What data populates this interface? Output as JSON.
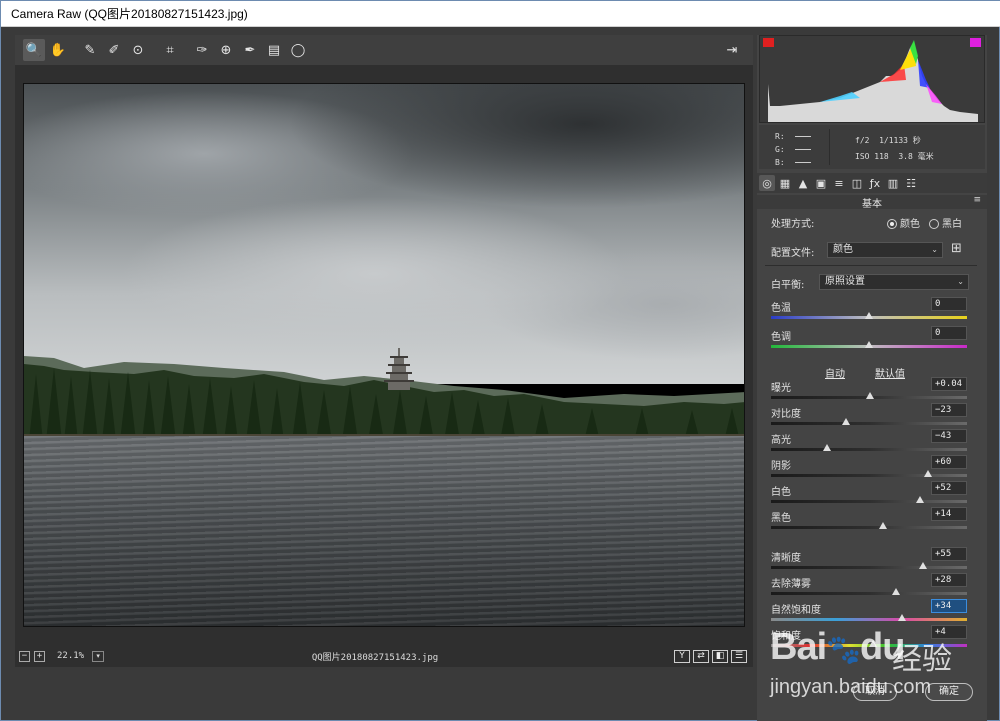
{
  "window": {
    "title": "Camera Raw (QQ图片20180827151423.jpg)"
  },
  "toolbar": {
    "tools": [
      {
        "icon": "zoom-icon",
        "glyph": "🔍"
      },
      {
        "icon": "hand-icon",
        "glyph": "✋"
      },
      {
        "icon": "white-balance-icon",
        "glyph": "✎"
      },
      {
        "icon": "color-sampler-icon",
        "glyph": "✐"
      },
      {
        "icon": "targeted-adjustment-icon",
        "glyph": "⊙"
      },
      {
        "icon": "crop-icon",
        "glyph": "⌗"
      },
      {
        "icon": "spot-removal-icon",
        "glyph": "✑"
      },
      {
        "icon": "red-eye-icon",
        "glyph": "⊕"
      },
      {
        "icon": "adjustment-brush-icon",
        "glyph": "✒"
      },
      {
        "icon": "graduated-filter-icon",
        "glyph": "▤"
      },
      {
        "icon": "radial-filter-icon",
        "glyph": "◯"
      }
    ],
    "open_object_icon": "⇥"
  },
  "status": {
    "zoom_minus": "−",
    "zoom_plus": "+",
    "zoom": "22.1%",
    "zoom_dropdown": "▾",
    "filename": "QQ图片20180827151423.jpg",
    "view_buttons": [
      "Y",
      "⇄",
      "◧",
      "☰"
    ]
  },
  "histogram": {
    "clip_shadow_color": "#e02020",
    "clip_highlight_color": "#e020e0"
  },
  "info": {
    "r_label": "R:",
    "g_label": "G:",
    "b_label": "B:",
    "aperture": "f/2",
    "shutter": "1/1133 秒",
    "iso": "ISO 118",
    "focal": "3.8 毫米"
  },
  "tabs": [
    "◎",
    "▦",
    "▲",
    "▣",
    "≡",
    "◫",
    "ƒx",
    "▥",
    "☷"
  ],
  "panel": {
    "title": "基本",
    "menu_icon": "≡",
    "treatment_label": "处理方式:",
    "treatment_color": "颜色",
    "treatment_bw": "黑白",
    "profile_label": "配置文件:",
    "profile_value": "颜色",
    "profile_grid_icon": "⊞",
    "wb_label": "白平衡:",
    "wb_value": "原照设置",
    "auto": "自动",
    "default": "默认值"
  },
  "sliders": [
    {
      "label": "色温",
      "value": "0",
      "pos": 0.5,
      "track": "temp"
    },
    {
      "label": "色调",
      "value": "0",
      "pos": 0.5,
      "track": "tint"
    },
    {
      "label": "曝光",
      "value": "+0.04",
      "pos": 0.505,
      "track": "gray"
    },
    {
      "label": "对比度",
      "value": "−23",
      "pos": 0.385,
      "track": "gray"
    },
    {
      "label": "高光",
      "value": "−43",
      "pos": 0.285,
      "track": "gray"
    },
    {
      "label": "阴影",
      "value": "+60",
      "pos": 0.8,
      "track": "gray"
    },
    {
      "label": "白色",
      "value": "+52",
      "pos": 0.76,
      "track": "gray"
    },
    {
      "label": "黑色",
      "value": "+14",
      "pos": 0.57,
      "track": "gray"
    },
    {
      "label": "清晰度",
      "value": "+55",
      "pos": 0.775,
      "track": "gray"
    },
    {
      "label": "去除薄雾",
      "value": "+28",
      "pos": 0.64,
      "track": "gray"
    },
    {
      "label": "自然饱和度",
      "value": "+34",
      "pos": 0.67,
      "track": "vib",
      "focus": true
    },
    {
      "label": "饱和度",
      "value": "+4",
      "pos": 0.52,
      "track": "sat"
    }
  ],
  "footer": {
    "cancel": "取消",
    "done": "确定"
  },
  "watermark": {
    "logo": "Bai",
    "logo2": "du",
    "cn": "经验",
    "url": "jingyan.baidu.com"
  }
}
